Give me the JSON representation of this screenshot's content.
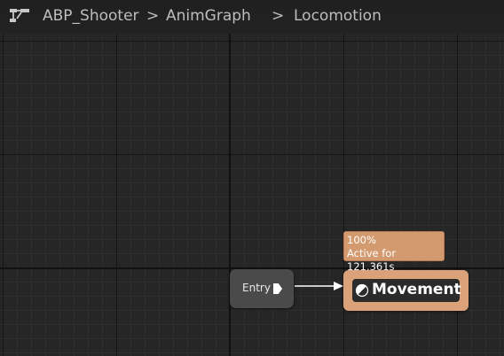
{
  "breadcrumb": {
    "icon": "graph-icon",
    "items": [
      "ABP_Shooter",
      "AnimGraph",
      "Locomotion"
    ],
    "separator": ">"
  },
  "graph": {
    "entry_node": {
      "label": "Entry",
      "pin_icon": "exec-pin-icon"
    },
    "state_node": {
      "name": "Movement",
      "icon": "state-icon",
      "debug": {
        "weight": "100%",
        "active_time": "Active for 121.361s"
      }
    }
  },
  "colors": {
    "canvas_background": "#262626",
    "state_active": "#dba27a",
    "debug_tooltip": "#d39a6f",
    "entry_node": "#4a4a4a"
  }
}
